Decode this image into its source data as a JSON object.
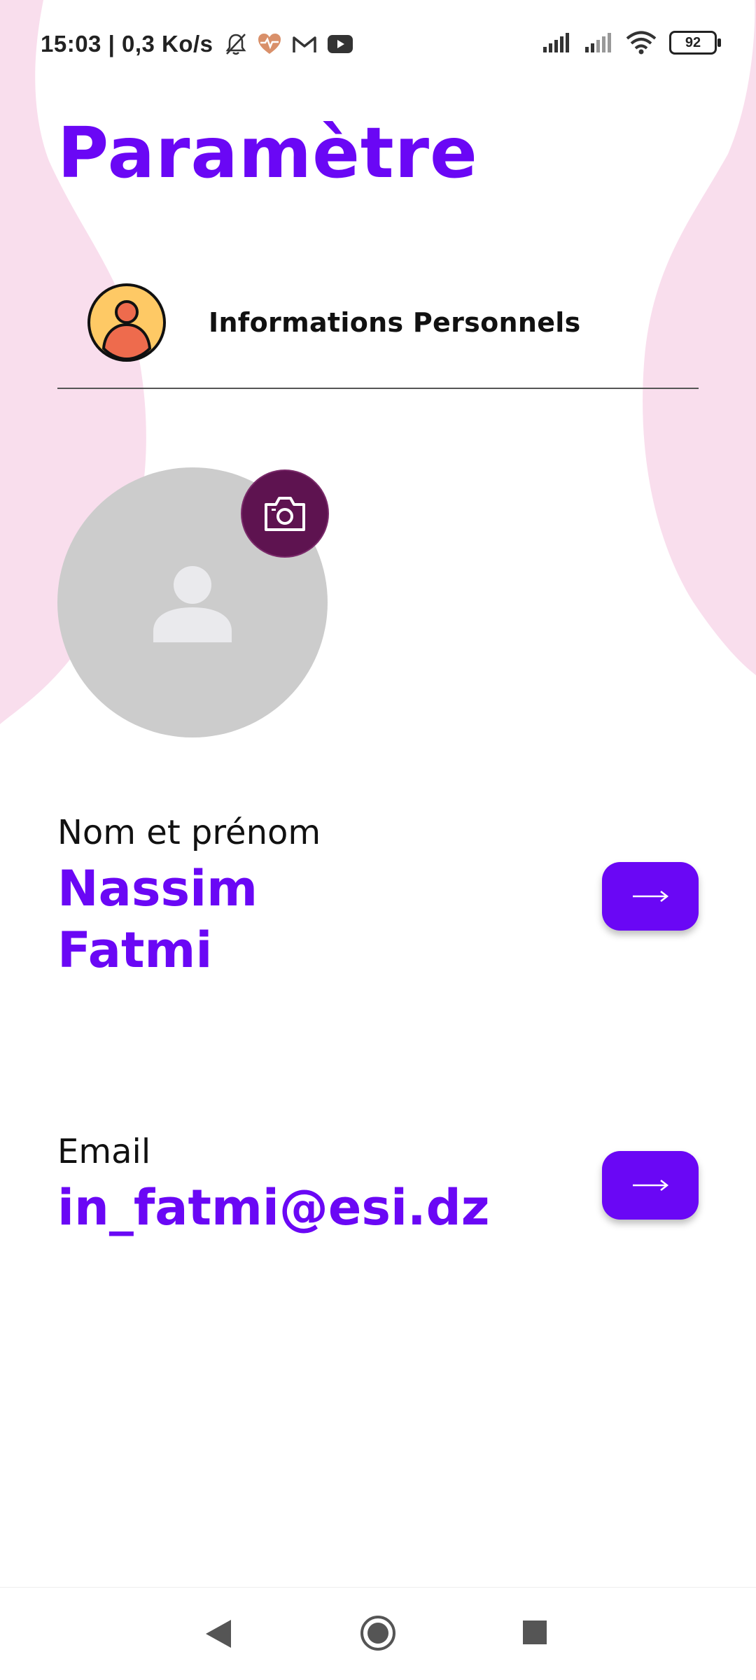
{
  "status_bar": {
    "time_speed": "15:03 | 0,3 Ko/s",
    "battery_level": "92",
    "icons": [
      "mute-bell-icon",
      "health-heart-icon",
      "gmail-icon",
      "youtube-icon",
      "signal-icon",
      "signal-icon-2",
      "wifi-icon",
      "battery-icon"
    ]
  },
  "page": {
    "title": "Paramètre"
  },
  "section": {
    "label": "Informations Personnels"
  },
  "profile": {
    "photo_alt_icon": "person-placeholder-icon",
    "camera_icon": "camera-icon"
  },
  "fields": {
    "name_label": "Nom et prénom",
    "name_value": "Nassim Fatmi",
    "email_label": "Email",
    "email_value": "in_fatmi@esi.dz"
  },
  "colors": {
    "accent": "#6A07F5",
    "camera_bg": "#5E1350",
    "bg_shape": "#F9DEED",
    "photo_bg": "#CCCCCC"
  },
  "navbar": {
    "icons": [
      "back-icon",
      "home-icon",
      "recents-icon"
    ]
  }
}
